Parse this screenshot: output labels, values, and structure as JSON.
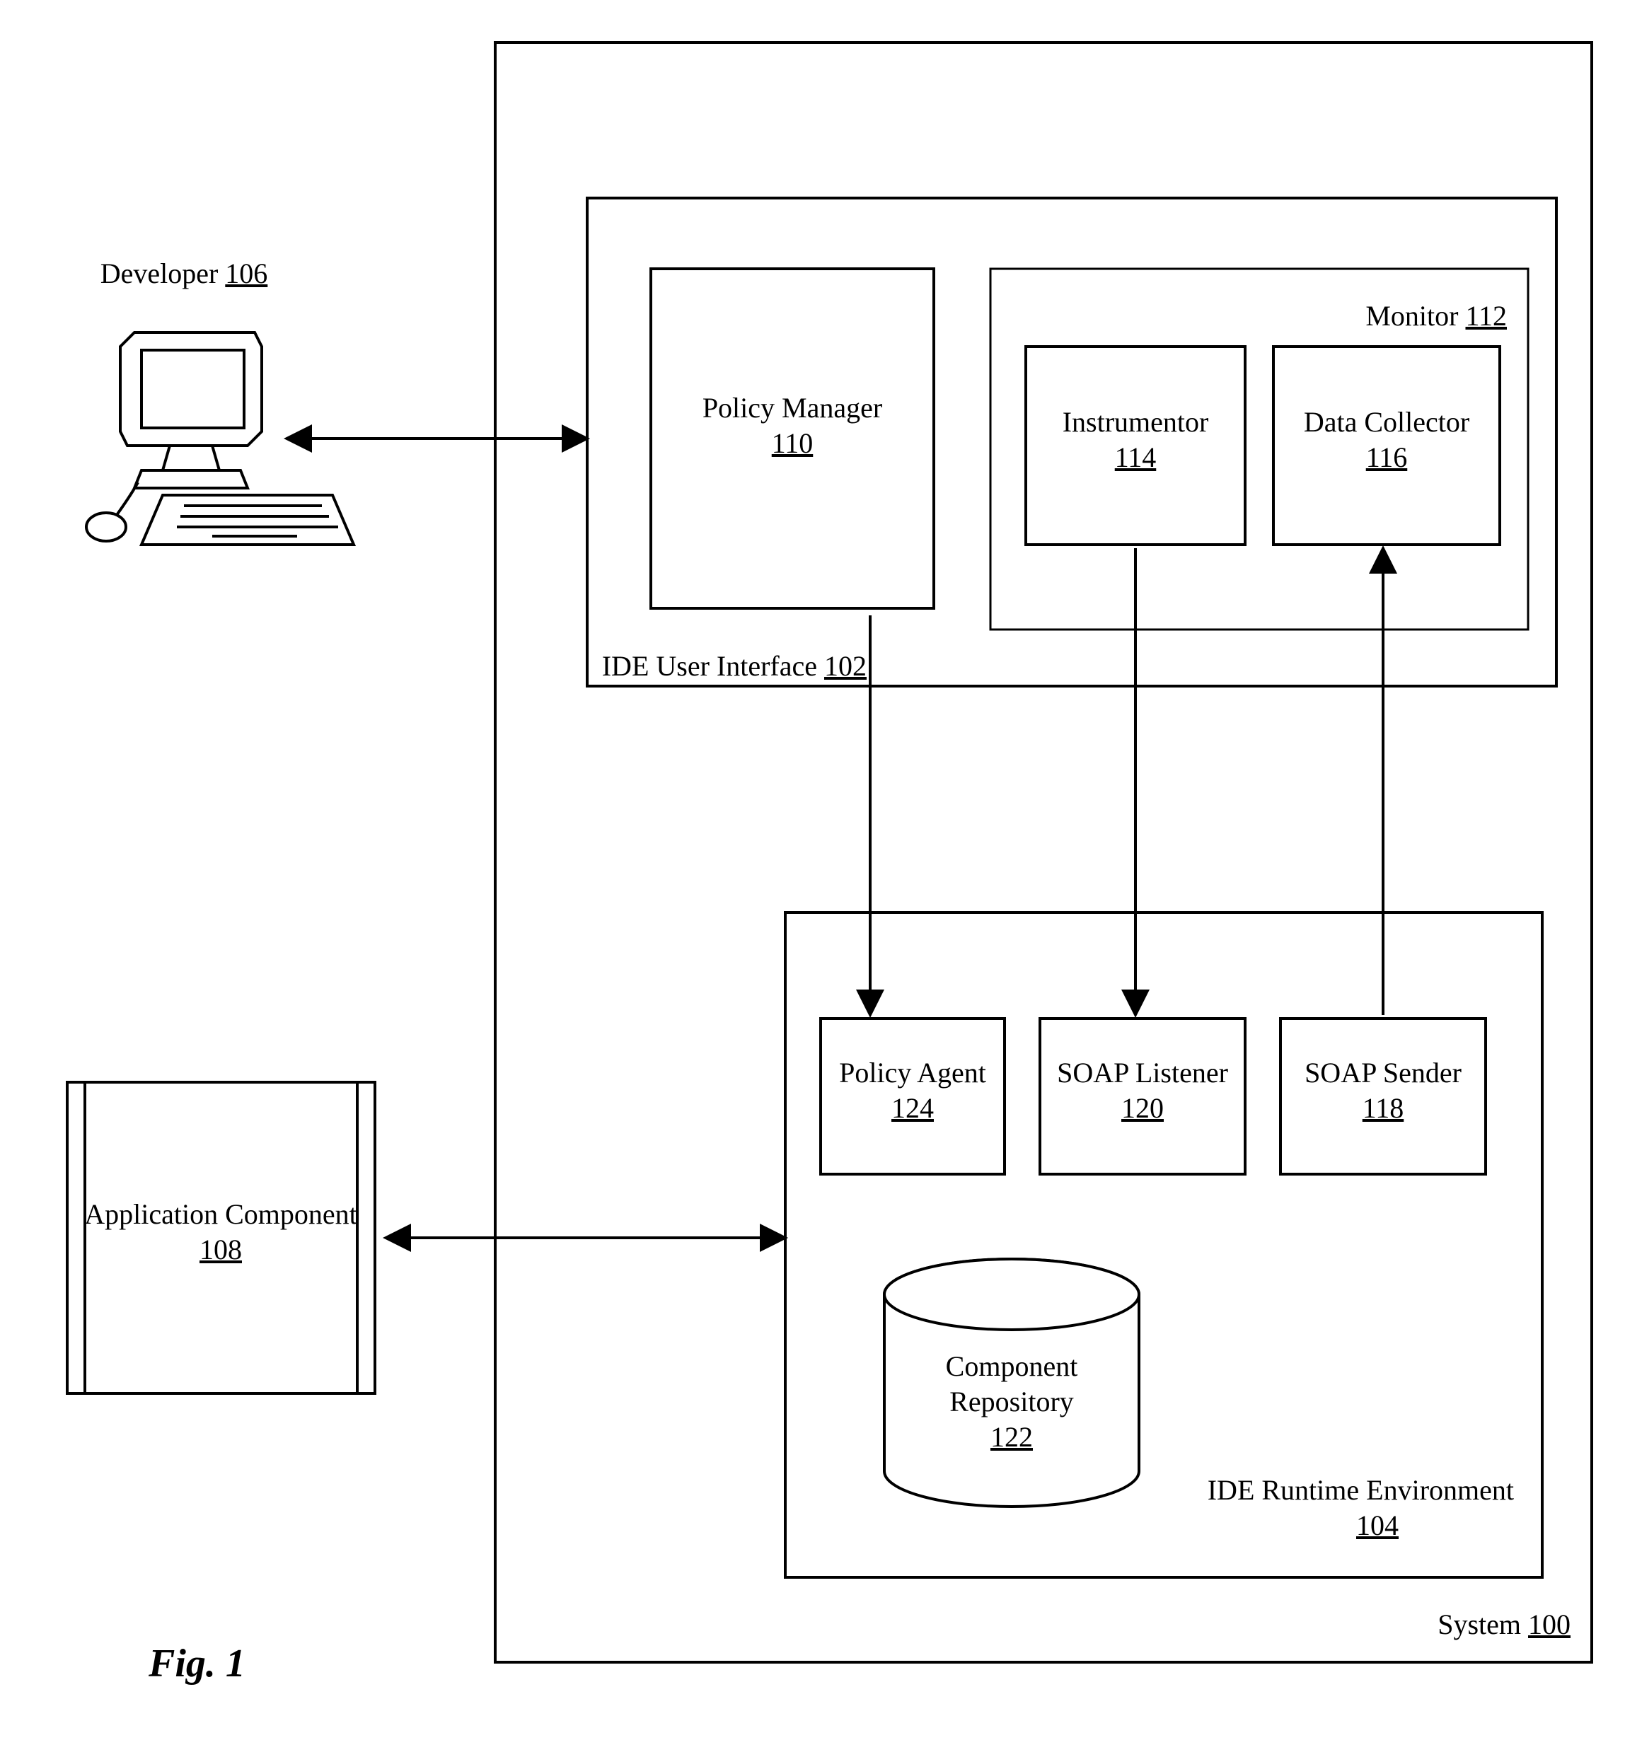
{
  "figure_label": "Fig. 1",
  "developer": {
    "label": "Developer",
    "ref": "106"
  },
  "app_component": {
    "label": "Application Component",
    "ref": "108"
  },
  "system": {
    "label": "System",
    "ref": "100"
  },
  "ide_ui": {
    "label": "IDE User Interface",
    "ref": "102"
  },
  "policy_manager": {
    "label": "Policy Manager",
    "ref": "110"
  },
  "monitor": {
    "label": "Monitor",
    "ref": "112"
  },
  "instrumentor": {
    "label": "Instrumentor",
    "ref": "114"
  },
  "data_collector": {
    "label": "Data Collector",
    "ref": "116"
  },
  "runtime": {
    "label": "IDE Runtime Environment",
    "ref": "104"
  },
  "policy_agent": {
    "label": "Policy Agent",
    "ref": "124"
  },
  "soap_listener": {
    "label": "SOAP Listener",
    "ref": "120"
  },
  "soap_sender": {
    "label": "SOAP Sender",
    "ref": "118"
  },
  "repository": {
    "label1": "Component",
    "label2": "Repository",
    "ref": "122"
  }
}
